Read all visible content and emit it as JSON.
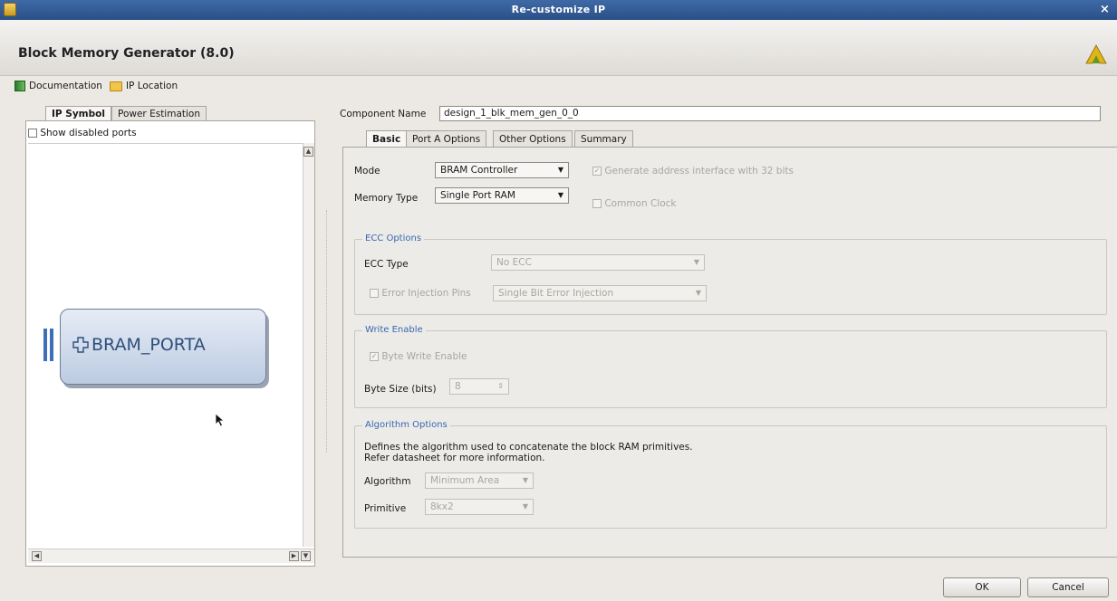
{
  "window": {
    "title": "Re-customize IP"
  },
  "header": {
    "ip_name": "Block Memory Generator (8.0)"
  },
  "links": {
    "documentation": "Documentation",
    "ip_location": "IP Location"
  },
  "left_panel": {
    "tabs": [
      {
        "label": "IP Symbol",
        "active": true
      },
      {
        "label": "Power Estimation",
        "active": false
      }
    ],
    "show_disabled_ports": {
      "label": "Show disabled ports",
      "checked": false
    },
    "symbol": {
      "port_label": "BRAM_PORTA"
    }
  },
  "component": {
    "label": "Component Name",
    "value": "design_1_blk_mem_gen_0_0"
  },
  "right_tabs": [
    {
      "label": "Basic",
      "active": true
    },
    {
      "label": "Port A Options",
      "active": false
    },
    {
      "label": "Other Options",
      "active": false
    },
    {
      "label": "Summary",
      "active": false
    }
  ],
  "basic": {
    "mode": {
      "label": "Mode",
      "value": "BRAM Controller"
    },
    "memory_type": {
      "label": "Memory Type",
      "value": "Single Port RAM"
    },
    "generate_address": {
      "label": "Generate address interface with 32 bits",
      "checked": true,
      "enabled": false
    },
    "common_clock": {
      "label": "Common Clock",
      "checked": false,
      "enabled": false
    },
    "ecc": {
      "title": "ECC Options",
      "type_label": "ECC Type",
      "type_value": "No ECC",
      "error_injection_label": "Error Injection Pins",
      "error_injection_value": "Single Bit Error Injection"
    },
    "write_enable": {
      "title": "Write Enable",
      "byte_write_label": "Byte Write Enable",
      "byte_size_label": "Byte Size (bits)",
      "byte_size_value": "8"
    },
    "algorithm": {
      "title": "Algorithm Options",
      "desc_line1": "Defines the algorithm used to concatenate the block RAM primitives.",
      "desc_line2": "Refer datasheet for more information.",
      "algorithm_label": "Algorithm",
      "algorithm_value": "Minimum Area",
      "primitive_label": "Primitive",
      "primitive_value": "8kx2"
    }
  },
  "buttons": {
    "ok": "OK",
    "cancel": "Cancel"
  },
  "colors": {
    "titlebar": "#2f5a96",
    "group_title": "#3a67b0",
    "bram_bar": "#3c6fb5"
  }
}
